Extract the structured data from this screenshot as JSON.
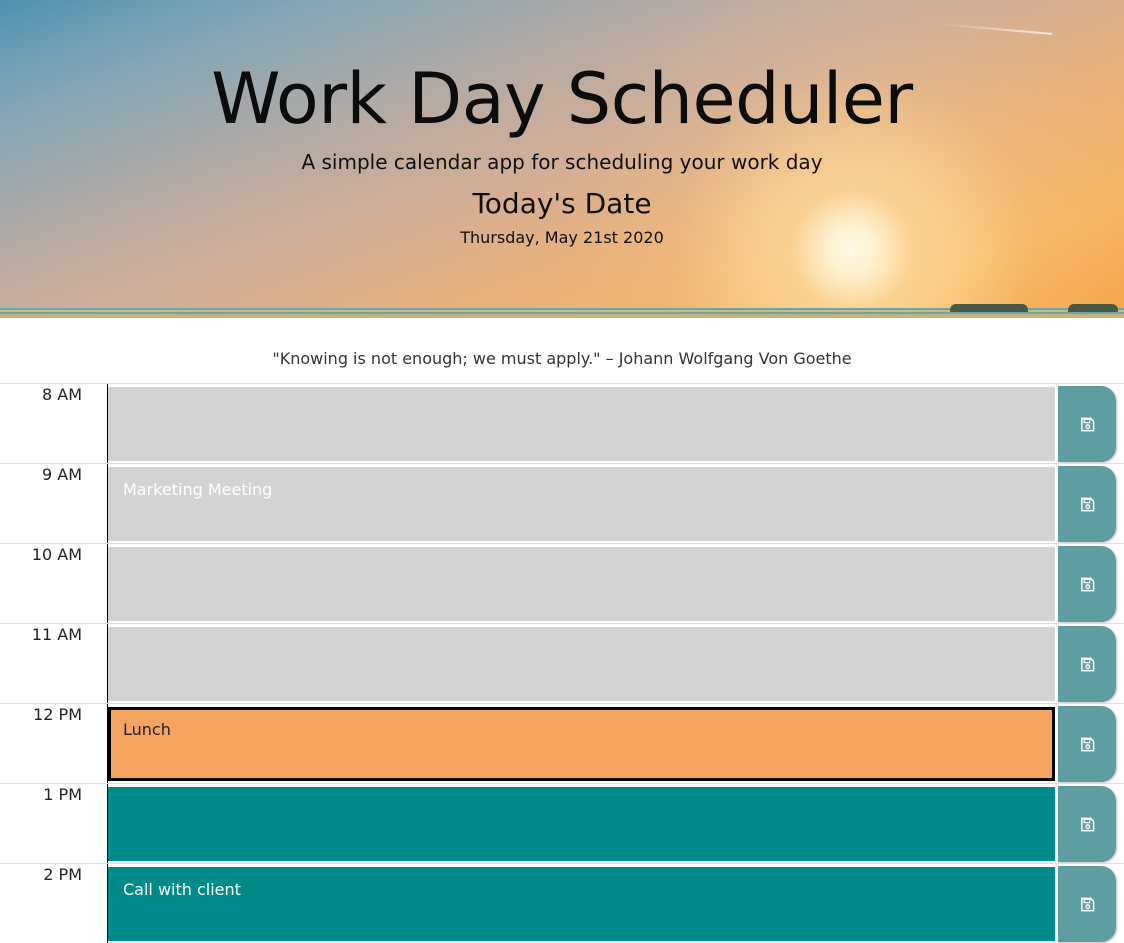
{
  "header": {
    "title": "Work Day Scheduler",
    "subtitle": "A simple calendar app for scheduling your work day",
    "date_heading": "Today's Date",
    "date_value": "Thursday, May 21st 2020"
  },
  "quote": "\"Knowing is not enough; we must apply.\" – Johann Wolfgang Von Goethe",
  "colors": {
    "past": "#d3d3d3",
    "present": "#f3a460",
    "future": "#008b8b",
    "save_button": "#5f9ea0"
  },
  "schedule": [
    {
      "hour": "8 AM",
      "text": "",
      "state": "past",
      "icon": "save-icon"
    },
    {
      "hour": "9 AM",
      "text": "Marketing Meeting",
      "state": "past",
      "icon": "save-icon"
    },
    {
      "hour": "10 AM",
      "text": "",
      "state": "past",
      "icon": "save-icon"
    },
    {
      "hour": "11 AM",
      "text": "",
      "state": "past",
      "icon": "save-icon"
    },
    {
      "hour": "12 PM",
      "text": "Lunch",
      "state": "present",
      "icon": "save-icon"
    },
    {
      "hour": "1 PM",
      "text": "",
      "state": "future",
      "icon": "save-icon"
    },
    {
      "hour": "2 PM",
      "text": "Call with client",
      "state": "future",
      "icon": "save-icon"
    }
  ]
}
